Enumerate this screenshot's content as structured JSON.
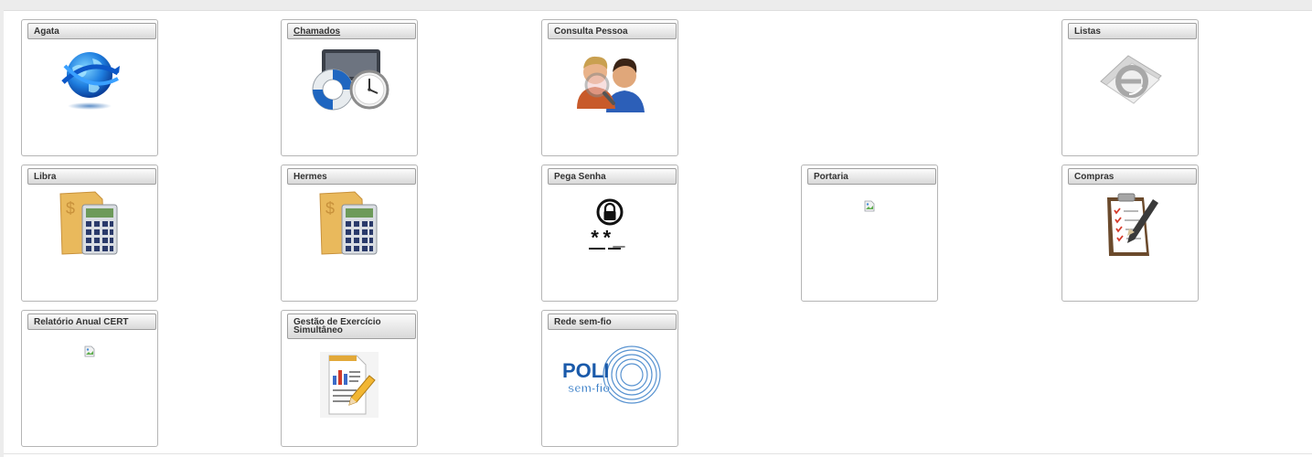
{
  "tiles": [
    {
      "label": "Agata",
      "icon": "globe-icon"
    },
    {
      "label": "Chamados",
      "icon": "lifebuoy-clock-icon"
    },
    {
      "label": "Consulta Pessoa",
      "icon": "people-search-icon"
    },
    {
      "label": "Listas",
      "icon": "email-icon"
    },
    {
      "label": "Libra",
      "icon": "calculator-icon"
    },
    {
      "label": "Hermes",
      "icon": "calculator-icon"
    },
    {
      "label": "Pega Senha",
      "icon": "password-lock-icon",
      "icon_text": "**_"
    },
    {
      "label": "Portaria",
      "icon": "broken-image-icon"
    },
    {
      "label": "Compras",
      "icon": "clipboard-checklist-icon"
    },
    {
      "label": "Relatório Anual CERT",
      "icon": "broken-image-icon"
    },
    {
      "label": "Gestão de Exercício Simultâneo",
      "icon": "report-edit-icon"
    },
    {
      "label": "Rede sem-fio",
      "icon": "poli-wireless-logo",
      "logo_text": "POLI",
      "logo_subtext": "sem-fio"
    }
  ],
  "colors": {
    "header_gradient_top": "#fbfbfb",
    "header_gradient_bottom": "#d9d9d9",
    "tile_border": "#b5b5b5"
  }
}
